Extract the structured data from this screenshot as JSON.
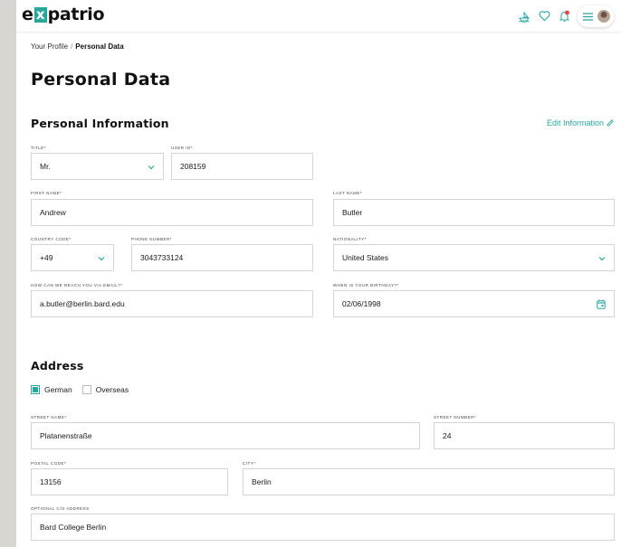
{
  "app": {
    "logo_pre": "e",
    "logo_x": "x",
    "logo_post": "patrio"
  },
  "breadcrumb": {
    "parent": "Your Profile",
    "separator": "/",
    "current": "Personal Data"
  },
  "page": {
    "title": "Personal Data"
  },
  "personal": {
    "section_title": "Personal Information",
    "edit_label": "Edit Information",
    "title": {
      "label": "TITLE*",
      "value": "Mr."
    },
    "user_id": {
      "label": "USER ID*",
      "value": "208159"
    },
    "first_name": {
      "label": "FIRST NAME*",
      "value": "Andrew"
    },
    "last_name": {
      "label": "LAST NAME*",
      "value": "Butler"
    },
    "country_code": {
      "label": "COUNTRY CODE*",
      "value": "+49"
    },
    "phone": {
      "label": "PHONE NUMBER*",
      "value": "3043733124"
    },
    "nationality": {
      "label": "NATIONALITY*",
      "value": "United States"
    },
    "email": {
      "label": "HOW CAN WE REACH YOU VIA EMAIL?*",
      "value": "a.butler@berlin.bard.edu"
    },
    "birthday": {
      "label": "WHEN IS YOUR BIRTHDAY?*",
      "value": "02/06/1998"
    }
  },
  "address": {
    "section_title": "Address",
    "option_german": "German",
    "option_overseas": "Overseas",
    "german_checked": true,
    "overseas_checked": false,
    "street_name": {
      "label": "STREET NAME*",
      "value": "Platanenstraße"
    },
    "street_number": {
      "label": "STREET NUMBER*",
      "value": "24"
    },
    "postal_code": {
      "label": "POSTAL CODE*",
      "value": "13156"
    },
    "city": {
      "label": "CITY*",
      "value": "Berlin"
    },
    "co_address": {
      "label": "OPTIONAL C/O ADDRESS",
      "value": "Bard College Berlin"
    }
  },
  "icons": [
    "boat-icon",
    "heart-icon",
    "bell-icon",
    "menu-icon",
    "avatar"
  ],
  "colors": {
    "accent": "#2aa79b",
    "notification": "#e64545",
    "background": "#d8d6d3"
  }
}
